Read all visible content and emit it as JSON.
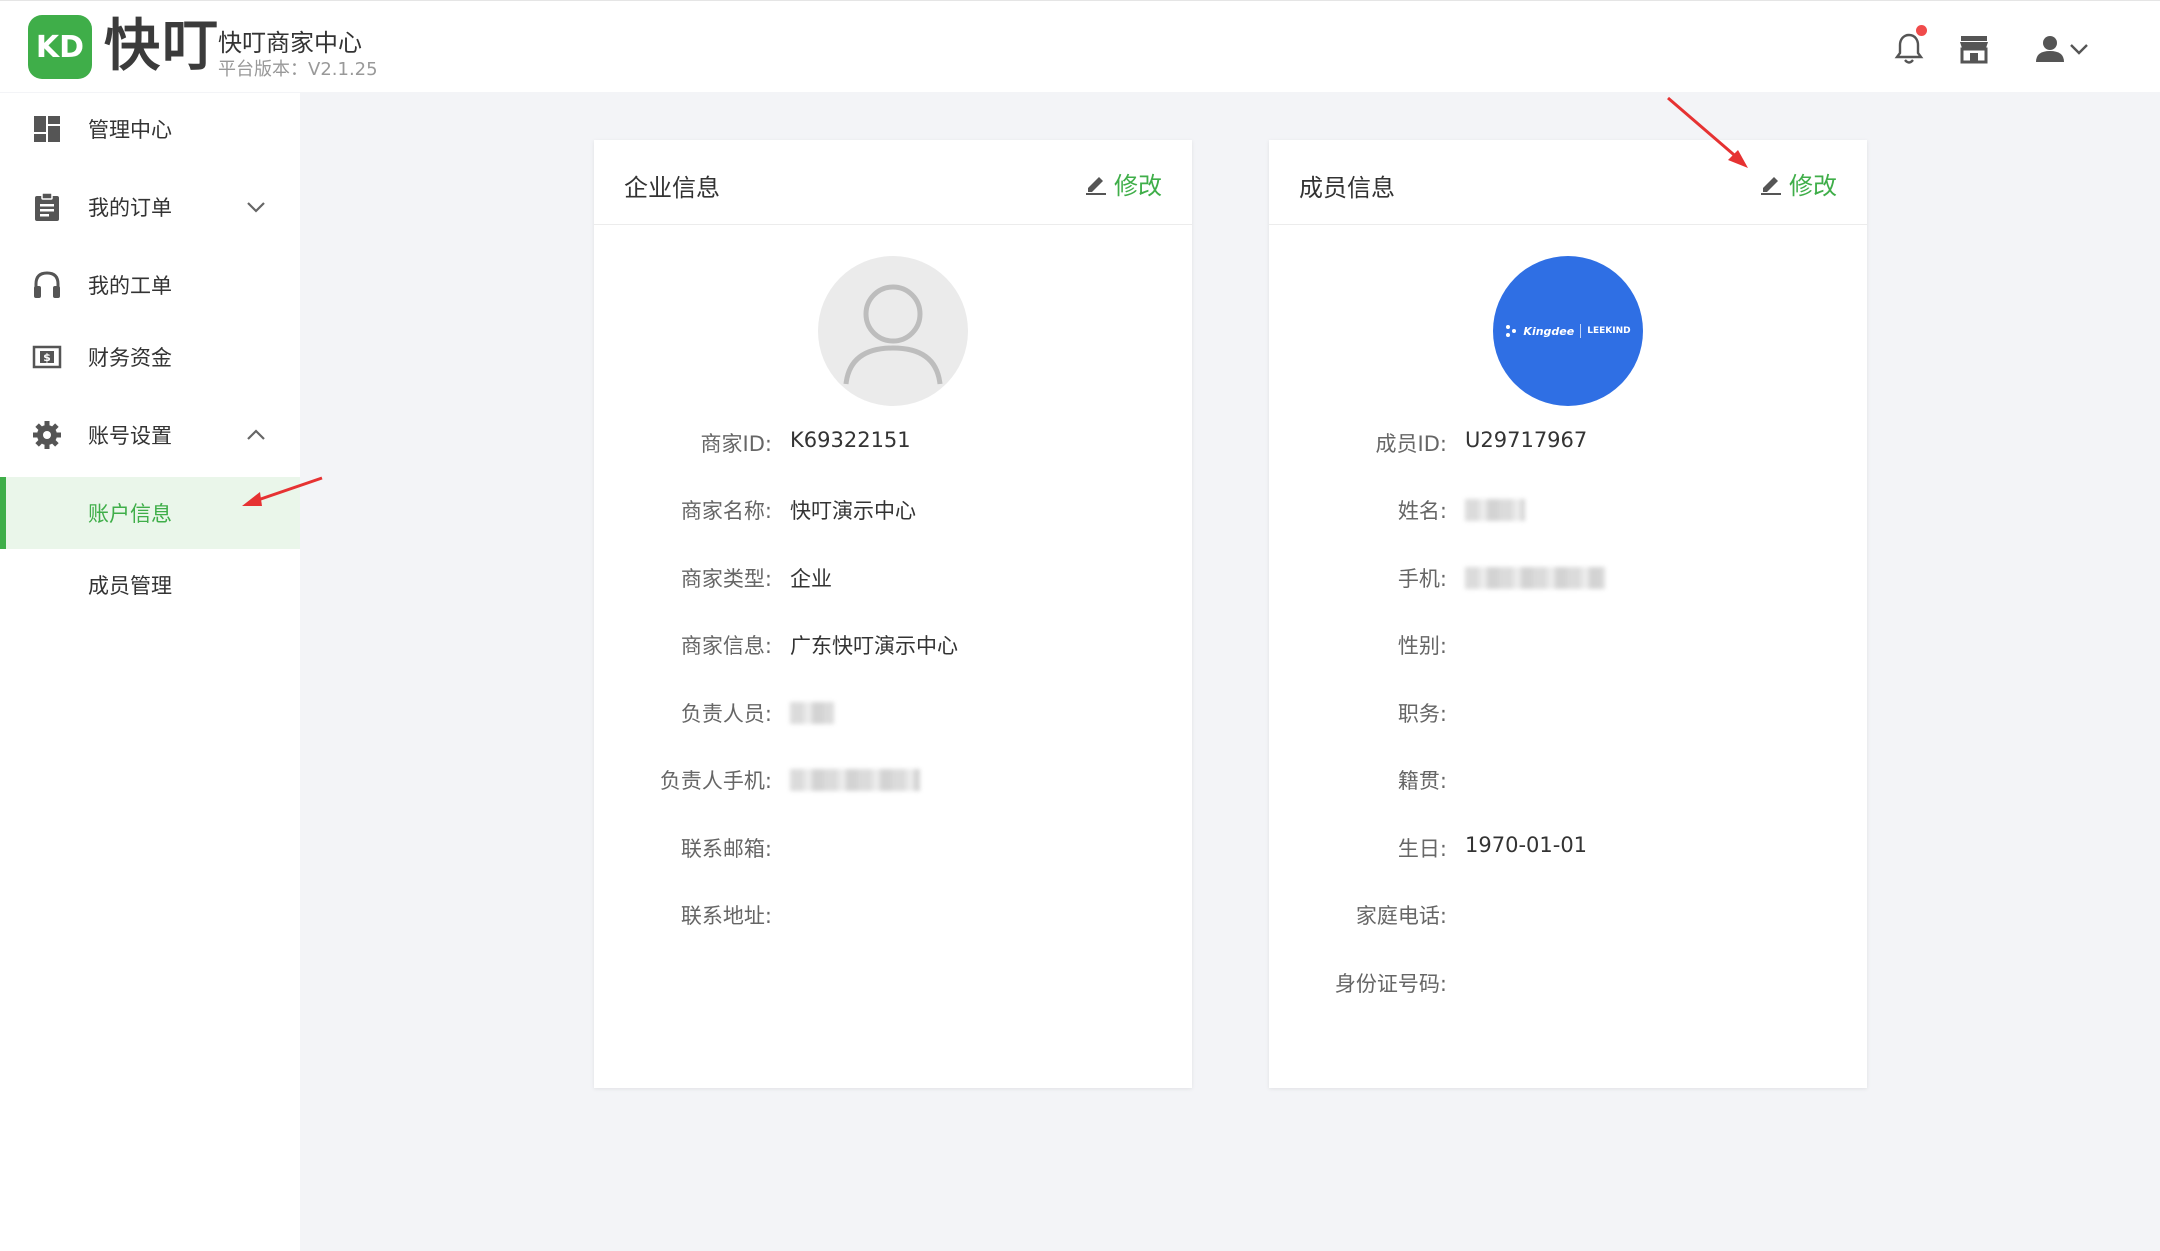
{
  "header": {
    "logo_mark": "KD",
    "logo_text": "快叮",
    "brand_title": "快叮商家中心",
    "brand_version": "平台版本：V2.1.25",
    "icons": [
      "bell-icon",
      "store-icon",
      "user-icon",
      "chevron-down-icon"
    ],
    "notification_dot_color": "#f04b4b"
  },
  "sidebar": {
    "items": [
      {
        "label": "管理中心",
        "icon": "dashboard-icon"
      },
      {
        "label": "我的订单",
        "icon": "clipboard-icon",
        "expand": "collapsed"
      },
      {
        "label": "我的工单",
        "icon": "headset-icon"
      },
      {
        "label": "财务资金",
        "icon": "money-icon"
      },
      {
        "label": "账号设置",
        "icon": "gear-icon",
        "expand": "expanded"
      }
    ],
    "subitems": [
      {
        "label": "账户信息",
        "active": true
      },
      {
        "label": "成员管理",
        "active": false
      }
    ]
  },
  "company_card": {
    "title": "企业信息",
    "edit_label": "修改",
    "fields": [
      {
        "key": "商家ID:",
        "value": "K69322151"
      },
      {
        "key": "商家名称:",
        "value": "快叮演示中心"
      },
      {
        "key": "商家类型:",
        "value": "企业"
      },
      {
        "key": "商家信息:",
        "value": "广东快叮演示中心"
      },
      {
        "key": "负责人员:",
        "value": ""
      },
      {
        "key": "负责人手机:",
        "value": ""
      },
      {
        "key": "联系邮箱:",
        "value": ""
      },
      {
        "key": "联系地址:",
        "value": ""
      }
    ]
  },
  "member_card": {
    "title": "成员信息",
    "edit_label": "修改",
    "avatar_text": "Kingdee",
    "avatar_text_2": "LEEKIND",
    "fields": [
      {
        "key": "成员ID:",
        "value": "U29717967"
      },
      {
        "key": "姓名:",
        "value": ""
      },
      {
        "key": "手机:",
        "value": ""
      },
      {
        "key": "性别:",
        "value": ""
      },
      {
        "key": "职务:",
        "value": ""
      },
      {
        "key": "籍贯:",
        "value": ""
      },
      {
        "key": "生日:",
        "value": "1970-01-01"
      },
      {
        "key": "家庭电话:",
        "value": ""
      },
      {
        "key": "身份证号码:",
        "value": ""
      }
    ]
  },
  "colors": {
    "accent": "#3fae49",
    "avatar_blue": "#2f6fe4",
    "annotation_red": "#e63232"
  }
}
